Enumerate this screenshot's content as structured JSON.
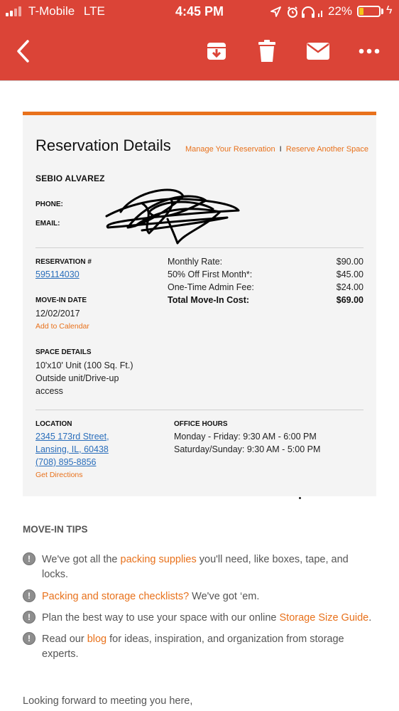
{
  "status_bar": {
    "carrier": "T-Mobile",
    "network": "LTE",
    "time": "4:45 PM",
    "battery_percent": "22%",
    "battery_level": 0.22,
    "icons": [
      "location-arrow-icon",
      "alarm-icon",
      "headphones-icon",
      "battery-icon",
      "charging-bolt-icon"
    ]
  },
  "toolbar": {
    "icons": [
      "back-arrow-icon",
      "archive-icon",
      "trash-icon",
      "mail-icon",
      "more-dots-icon"
    ]
  },
  "colors": {
    "header": "#db4437",
    "accent": "#e8711b",
    "link": "#2a6ebb",
    "card_bg": "#f4f4f4"
  },
  "reservation": {
    "title": "Reservation Details",
    "manage_link": "Manage Your Reservation",
    "link_separator": "I",
    "reserve_link": "Reserve Another Space",
    "customer_name": "SEBIO ALVAREZ",
    "phone_label": "PHONE:",
    "email_label": "EMAIL:",
    "reservation_label": "RESERVATION #",
    "reservation_number": "595114030",
    "movein_label": "MOVE-IN DATE",
    "movein_date": "12/02/2017",
    "add_calendar": "Add to Calendar",
    "space_label": "SPACE DETAILS",
    "space_line1": "10'x10' Unit (100 Sq. Ft.)",
    "space_line2": "Outside unit/Drive-up",
    "space_line3": "access",
    "location_label": "LOCATION",
    "address_line1": "2345 173rd Street,",
    "address_line2": "Lansing, IL, 60438",
    "address_phone": "(708) 895-8856",
    "directions": "Get Directions",
    "hours_label": "OFFICE HOURS",
    "hours_weekday": "Monday - Friday: 9:30 AM - 6:00 PM",
    "hours_weekend": "Saturday/Sunday: 9:30 AM - 5:00 PM",
    "costs": [
      {
        "label": "Monthly Rate:",
        "amount": "$90.00"
      },
      {
        "label": "50% Off First Month*:",
        "amount": "$45.00"
      },
      {
        "label": "One-Time Admin Fee:",
        "amount": "$24.00"
      },
      {
        "label": "Total Move-In Cost:",
        "amount": "$69.00"
      }
    ]
  },
  "tips": {
    "title": "MOVE-IN TIPS",
    "items": [
      {
        "before": "We've got all the ",
        "link": "packing supplies",
        "after": " you'll need, like boxes, tape, and locks."
      },
      {
        "before": "",
        "link": "Packing and storage checklists?",
        "after": " We've got ‘em."
      },
      {
        "before": "Plan the best way to use your space with our online ",
        "link": "Storage Size Guide",
        "after": "."
      },
      {
        "before": "Read our ",
        "link": "blog",
        "after": " for ideas, inspiration, and organization from storage experts."
      }
    ]
  },
  "closing": "Looking forward to meeting you here,"
}
